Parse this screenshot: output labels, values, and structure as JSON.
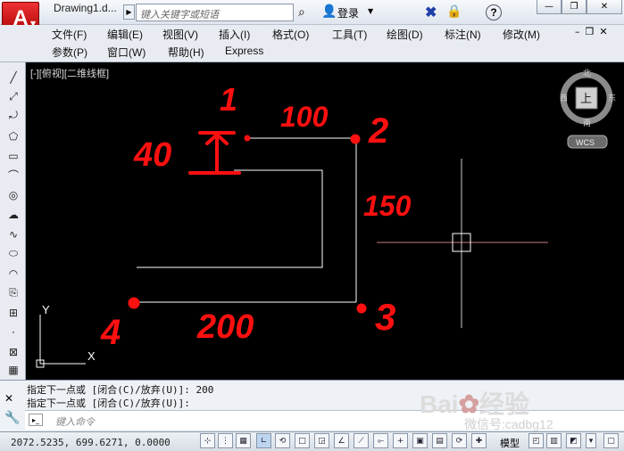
{
  "app": {
    "logo_letter": "A",
    "doc_title": "Drawing1.d...",
    "search_placeholder": "键入关键字或短语",
    "login_label": "登录"
  },
  "menu": {
    "row1": [
      "文件(F)",
      "编辑(E)",
      "视图(V)",
      "插入(I)",
      "格式(O)",
      "工具(T)",
      "绘图(D)",
      "标注(N)",
      "修改(M)"
    ],
    "row2": [
      "参数(P)",
      "窗口(W)",
      "帮助(H)",
      "Express"
    ]
  },
  "viewport": {
    "label": "[-][俯视][二维线框]"
  },
  "viewcube": {
    "north": "北",
    "south": "南",
    "west": "西",
    "east": "东",
    "top": "上",
    "wcs": "WCS"
  },
  "ucs": {
    "x": "X",
    "y": "Y"
  },
  "annotations": {
    "p1": "1",
    "p2": "2",
    "p3": "3",
    "p4": "4",
    "d40": "40",
    "d100": "100",
    "d150": "150",
    "d200": "200"
  },
  "command": {
    "line1": "指定下一点或 [闭合(C)/放弃(U)]:  200",
    "line2": "指定下一点或 [闭合(C)/放弃(U)]:",
    "input_placeholder": "键入命令"
  },
  "status": {
    "coords": "2072.5235, 699.6271, 0.0000",
    "model_label": "模型"
  },
  "watermark": {
    "brand": "Bai",
    "brand2": "经验",
    "sub": "微信号:cadbg12"
  },
  "colors": {
    "canvas": "#000000",
    "annotation_red": "#ff1010",
    "lines": "#ffffff",
    "crosshair_h": "#c87a7a"
  }
}
